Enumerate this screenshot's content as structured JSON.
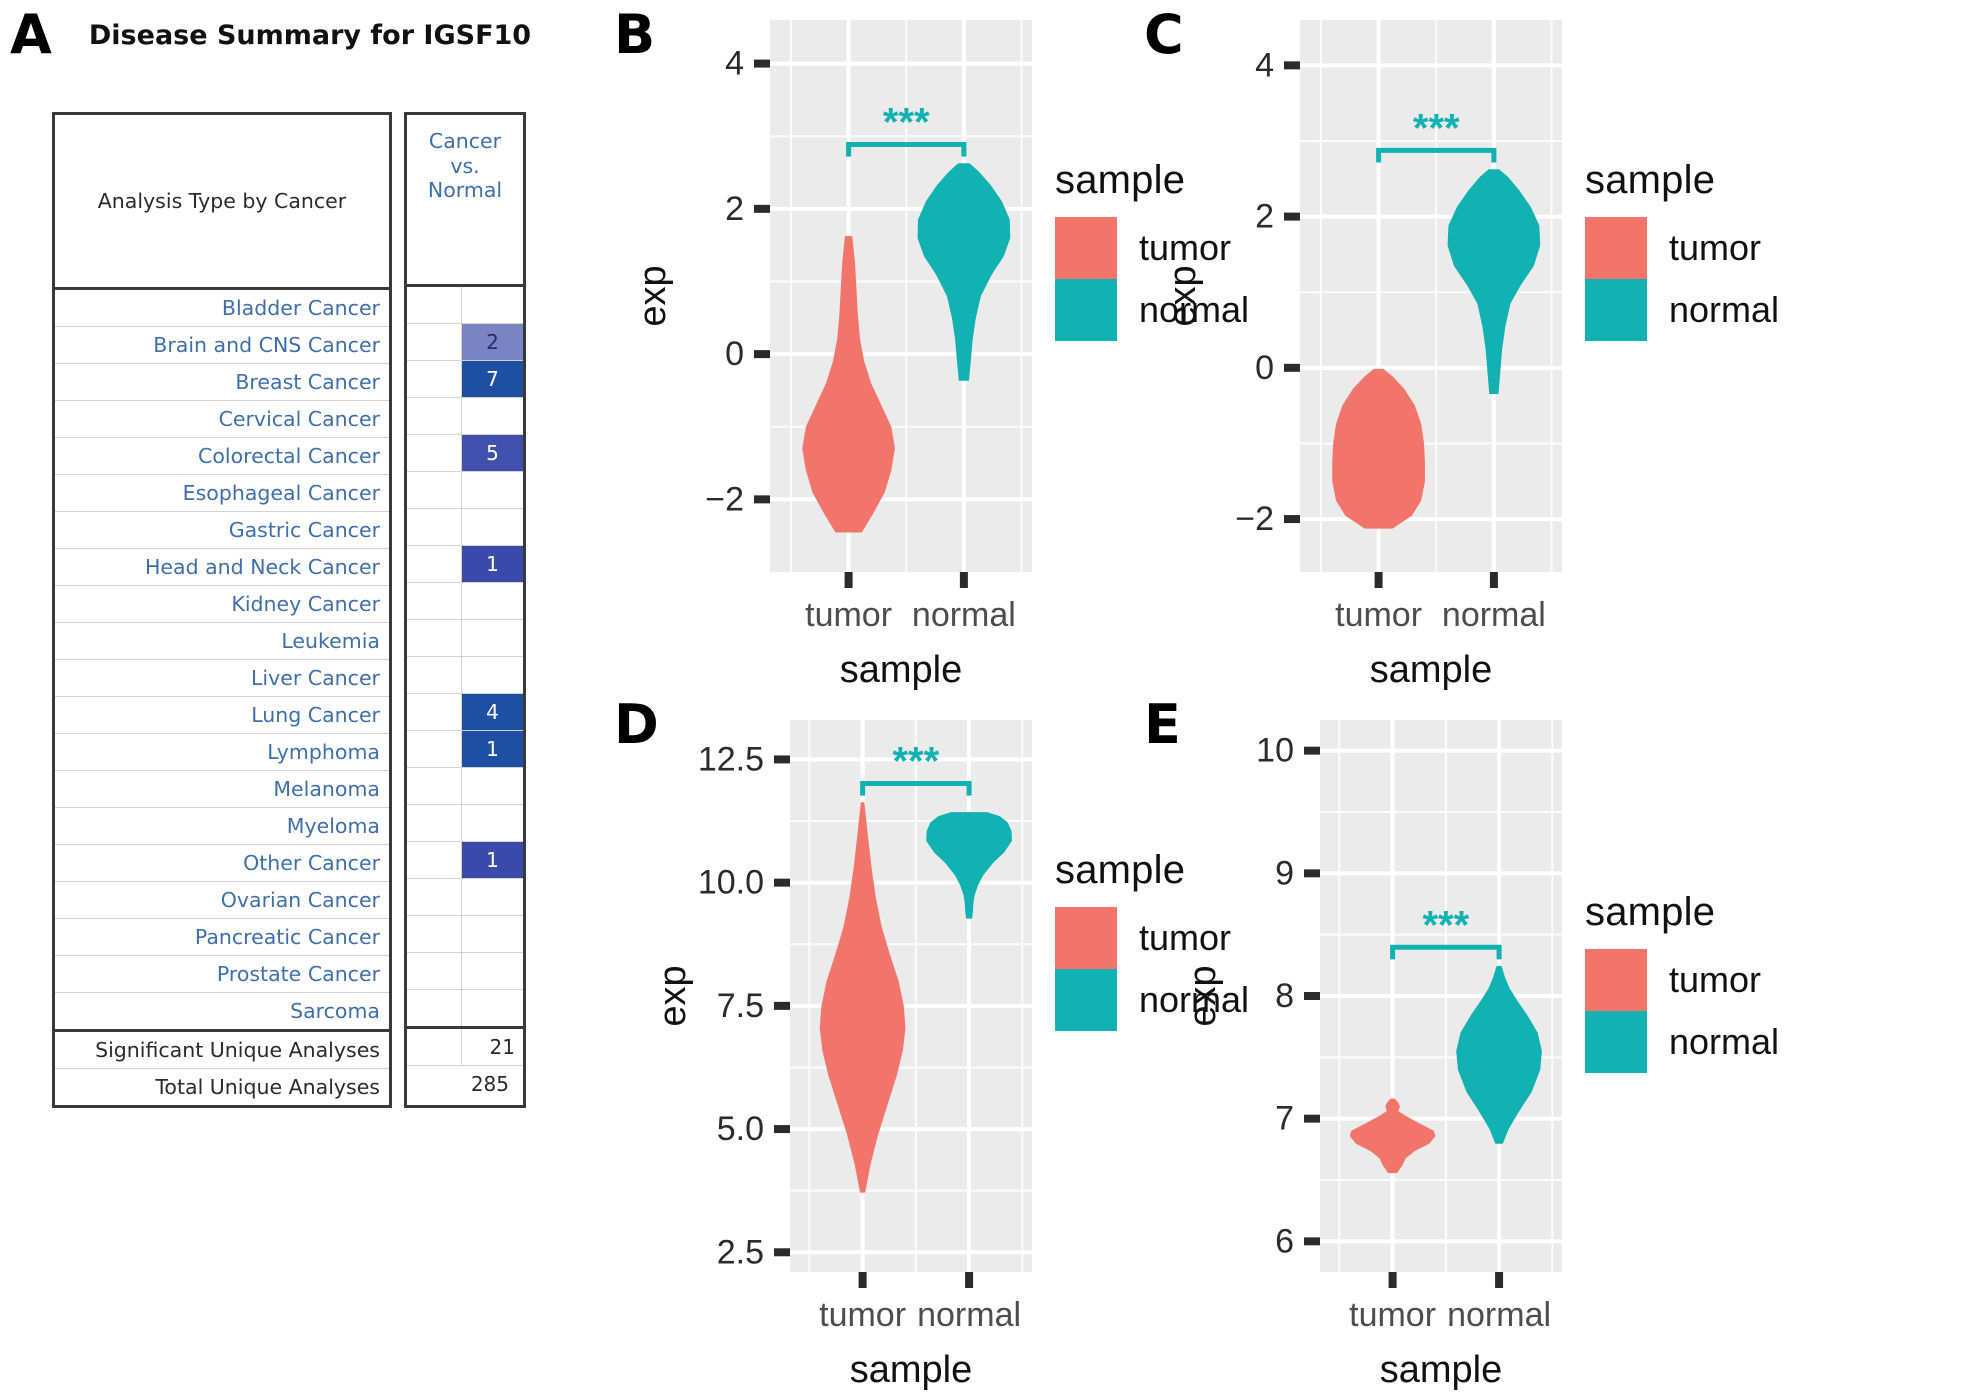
{
  "panels": {
    "a": {
      "letter": "A"
    },
    "b": {
      "letter": "B"
    },
    "c": {
      "letter": "C"
    },
    "d": {
      "letter": "D"
    },
    "e": {
      "letter": "E"
    }
  },
  "table": {
    "title": "Disease Summary for IGSF10",
    "header_left": "Analysis Type by Cancer",
    "header_right": "Cancer\nvs.\nNormal",
    "header_right_lines": [
      "Cancer",
      "vs.",
      "Normal"
    ],
    "rows": [
      {
        "label": "Bladder Cancer",
        "value": "",
        "shade": ""
      },
      {
        "label": "Brain and CNS Cancer",
        "value": "2",
        "shade": "#7b83c4"
      },
      {
        "label": "Breast Cancer",
        "value": "7",
        "shade": "#1f4fa3"
      },
      {
        "label": "Cervical Cancer",
        "value": "",
        "shade": ""
      },
      {
        "label": "Colorectal Cancer",
        "value": "5",
        "shade": "#4050ad"
      },
      {
        "label": "Esophageal Cancer",
        "value": "",
        "shade": ""
      },
      {
        "label": "Gastric Cancer",
        "value": "",
        "shade": ""
      },
      {
        "label": "Head and Neck Cancer",
        "value": "1",
        "shade": "#3b49ab"
      },
      {
        "label": "Kidney Cancer",
        "value": "",
        "shade": ""
      },
      {
        "label": "Leukemia",
        "value": "",
        "shade": ""
      },
      {
        "label": "Liver Cancer",
        "value": "",
        "shade": ""
      },
      {
        "label": "Lung Cancer",
        "value": "4",
        "shade": "#1f4fa3"
      },
      {
        "label": "Lymphoma",
        "value": "1",
        "shade": "#1f4fa3"
      },
      {
        "label": "Melanoma",
        "value": "",
        "shade": ""
      },
      {
        "label": "Myeloma",
        "value": "",
        "shade": ""
      },
      {
        "label": "Other Cancer",
        "value": "1",
        "shade": "#3b49ab"
      },
      {
        "label": "Ovarian Cancer",
        "value": "",
        "shade": ""
      },
      {
        "label": "Pancreatic Cancer",
        "value": "",
        "shade": ""
      },
      {
        "label": "Prostate Cancer",
        "value": "",
        "shade": ""
      },
      {
        "label": "Sarcoma",
        "value": "",
        "shade": ""
      }
    ],
    "footer": [
      {
        "label": "Significant Unique Analyses",
        "value": "21",
        "span": false
      },
      {
        "label": "Total Unique Analyses",
        "value": "285",
        "span": true
      }
    ]
  },
  "colors": {
    "tumor": "#F2756B",
    "normal": "#12B2B2",
    "panel_bg": "#EBEBEB",
    "grid": "#FFFFFF",
    "sig_text": "#12B2B2",
    "table_link": "#3f6fa8"
  },
  "legend": {
    "title": "sample",
    "items": [
      {
        "label": "tumor",
        "color": "#F2756B"
      },
      {
        "label": "normal",
        "color": "#12B2B2"
      }
    ]
  },
  "chart_data": [
    {
      "panel": "B",
      "type": "violin",
      "title": "",
      "xlabel": "sample",
      "ylabel": "exp",
      "significance": "***",
      "xticks": [
        "tumor",
        "normal"
      ],
      "yticks": [
        -2,
        0,
        2,
        4
      ],
      "ytick_labels": [
        "−2",
        "0",
        "2",
        "4"
      ],
      "ylim": [
        -3.0,
        4.6
      ],
      "grid": true,
      "legend_position": "right",
      "series": [
        {
          "name": "tumor",
          "color": "#F2756B",
          "min": -2.45,
          "max": 1.62,
          "median": -1.45,
          "q1": -1.95,
          "q3": -0.85,
          "profile": [
            [
              -2.45,
              0.28
            ],
            [
              -2.2,
              0.52
            ],
            [
              -1.9,
              0.78
            ],
            [
              -1.6,
              0.92
            ],
            [
              -1.3,
              1.0
            ],
            [
              -1.0,
              0.92
            ],
            [
              -0.7,
              0.7
            ],
            [
              -0.4,
              0.48
            ],
            [
              -0.1,
              0.33
            ],
            [
              0.2,
              0.24
            ],
            [
              0.55,
              0.19
            ],
            [
              0.9,
              0.16
            ],
            [
              1.25,
              0.13
            ],
            [
              1.62,
              0.07
            ]
          ]
        },
        {
          "name": "normal",
          "color": "#12B2B2",
          "min": -0.36,
          "max": 2.62,
          "median": 1.72,
          "q1": 1.3,
          "q3": 2.0,
          "profile": [
            [
              -0.36,
              0.1
            ],
            [
              -0.1,
              0.14
            ],
            [
              0.2,
              0.18
            ],
            [
              0.5,
              0.25
            ],
            [
              0.8,
              0.36
            ],
            [
              1.1,
              0.6
            ],
            [
              1.35,
              0.86
            ],
            [
              1.6,
              1.0
            ],
            [
              1.85,
              0.99
            ],
            [
              2.1,
              0.82
            ],
            [
              2.32,
              0.58
            ],
            [
              2.5,
              0.33
            ],
            [
              2.62,
              0.12
            ]
          ]
        }
      ]
    },
    {
      "panel": "C",
      "type": "violin",
      "title": "",
      "xlabel": "sample",
      "ylabel": "exp",
      "significance": "***",
      "xticks": [
        "tumor",
        "normal"
      ],
      "yticks": [
        -2,
        0,
        2,
        4
      ],
      "ytick_labels": [
        "−2",
        "0",
        "2",
        "4"
      ],
      "ylim": [
        -2.7,
        4.6
      ],
      "grid": true,
      "legend_position": "right",
      "series": [
        {
          "name": "tumor",
          "color": "#F2756B",
          "min": -2.12,
          "max": -0.02,
          "median": -1.25,
          "q1": -1.7,
          "q3": -0.8,
          "profile": [
            [
              -2.12,
              0.3
            ],
            [
              -1.95,
              0.72
            ],
            [
              -1.75,
              0.92
            ],
            [
              -1.5,
              1.0
            ],
            [
              -1.25,
              1.0
            ],
            [
              -1.0,
              0.98
            ],
            [
              -0.75,
              0.92
            ],
            [
              -0.5,
              0.78
            ],
            [
              -0.28,
              0.55
            ],
            [
              -0.12,
              0.3
            ],
            [
              -0.02,
              0.1
            ]
          ]
        },
        {
          "name": "normal",
          "color": "#12B2B2",
          "min": -0.34,
          "max": 2.62,
          "median": 1.7,
          "q1": 1.25,
          "q3": 1.98,
          "profile": [
            [
              -0.34,
              0.09
            ],
            [
              -0.05,
              0.13
            ],
            [
              0.25,
              0.17
            ],
            [
              0.55,
              0.24
            ],
            [
              0.85,
              0.35
            ],
            [
              1.1,
              0.58
            ],
            [
              1.35,
              0.86
            ],
            [
              1.62,
              1.0
            ],
            [
              1.88,
              0.98
            ],
            [
              2.12,
              0.8
            ],
            [
              2.34,
              0.55
            ],
            [
              2.52,
              0.3
            ],
            [
              2.62,
              0.11
            ]
          ]
        }
      ]
    },
    {
      "panel": "D",
      "type": "violin",
      "title": "",
      "xlabel": "sample",
      "ylabel": "exp",
      "significance": "***",
      "xticks": [
        "tumor",
        "normal"
      ],
      "yticks": [
        2.5,
        5.0,
        7.5,
        10.0,
        12.5
      ],
      "ytick_labels": [
        "2.5",
        "5.0",
        "7.5",
        "10.0",
        "12.5"
      ],
      "ylim": [
        2.1,
        13.3
      ],
      "grid": true,
      "legend_position": "right",
      "series": [
        {
          "name": "tumor",
          "color": "#F2756B",
          "min": 3.72,
          "max": 11.62,
          "median": 7.05,
          "q1": 6.1,
          "q3": 8.1,
          "profile": [
            [
              3.72,
              0.05
            ],
            [
              4.3,
              0.18
            ],
            [
              4.9,
              0.36
            ],
            [
              5.5,
              0.58
            ],
            [
              6.1,
              0.8
            ],
            [
              6.6,
              0.94
            ],
            [
              7.05,
              1.0
            ],
            [
              7.5,
              0.96
            ],
            [
              8.0,
              0.84
            ],
            [
              8.55,
              0.63
            ],
            [
              9.1,
              0.44
            ],
            [
              9.7,
              0.3
            ],
            [
              10.3,
              0.2
            ],
            [
              10.9,
              0.12
            ],
            [
              11.3,
              0.07
            ],
            [
              11.62,
              0.03
            ]
          ]
        },
        {
          "name": "normal",
          "color": "#12B2B2",
          "min": 9.28,
          "max": 11.42,
          "median": 10.9,
          "q1": 10.6,
          "q3": 11.1,
          "profile": [
            [
              9.28,
              0.06
            ],
            [
              9.42,
              0.08
            ],
            [
              9.58,
              0.09
            ],
            [
              9.75,
              0.12
            ],
            [
              9.95,
              0.2
            ],
            [
              10.15,
              0.32
            ],
            [
              10.4,
              0.55
            ],
            [
              10.62,
              0.82
            ],
            [
              10.85,
              1.0
            ],
            [
              11.05,
              0.99
            ],
            [
              11.22,
              0.9
            ],
            [
              11.34,
              0.72
            ],
            [
              11.42,
              0.42
            ]
          ]
        }
      ]
    },
    {
      "panel": "E",
      "type": "violin",
      "title": "",
      "xlabel": "sample",
      "ylabel": "exp",
      "significance": "***",
      "xticks": [
        "tumor",
        "normal"
      ],
      "yticks": [
        6,
        7,
        8,
        9,
        10
      ],
      "ytick_labels": [
        "6",
        "7",
        "8",
        "9",
        "10"
      ],
      "ylim": [
        5.75,
        10.25
      ],
      "grid": true,
      "legend_position": "right",
      "series": [
        {
          "name": "tumor",
          "color": "#F2756B",
          "min": 6.56,
          "max": 7.16,
          "median": 6.88,
          "q1": 6.78,
          "q3": 6.96,
          "profile": [
            [
              6.56,
              0.1
            ],
            [
              6.62,
              0.22
            ],
            [
              6.68,
              0.3
            ],
            [
              6.74,
              0.52
            ],
            [
              6.8,
              0.86
            ],
            [
              6.86,
              1.0
            ],
            [
              6.9,
              0.96
            ],
            [
              6.96,
              0.62
            ],
            [
              7.02,
              0.3
            ],
            [
              7.06,
              0.12
            ],
            [
              7.1,
              0.16
            ],
            [
              7.13,
              0.12
            ],
            [
              7.16,
              0.04
            ]
          ]
        },
        {
          "name": "normal",
          "color": "#12B2B2",
          "min": 6.8,
          "max": 8.24,
          "median": 7.52,
          "q1": 7.32,
          "q3": 7.72,
          "profile": [
            [
              6.8,
              0.08
            ],
            [
              6.92,
              0.22
            ],
            [
              7.06,
              0.46
            ],
            [
              7.22,
              0.76
            ],
            [
              7.4,
              0.96
            ],
            [
              7.55,
              1.0
            ],
            [
              7.7,
              0.9
            ],
            [
              7.84,
              0.66
            ],
            [
              7.96,
              0.42
            ],
            [
              8.06,
              0.24
            ],
            [
              8.15,
              0.13
            ],
            [
              8.24,
              0.05
            ]
          ]
        }
      ]
    }
  ]
}
